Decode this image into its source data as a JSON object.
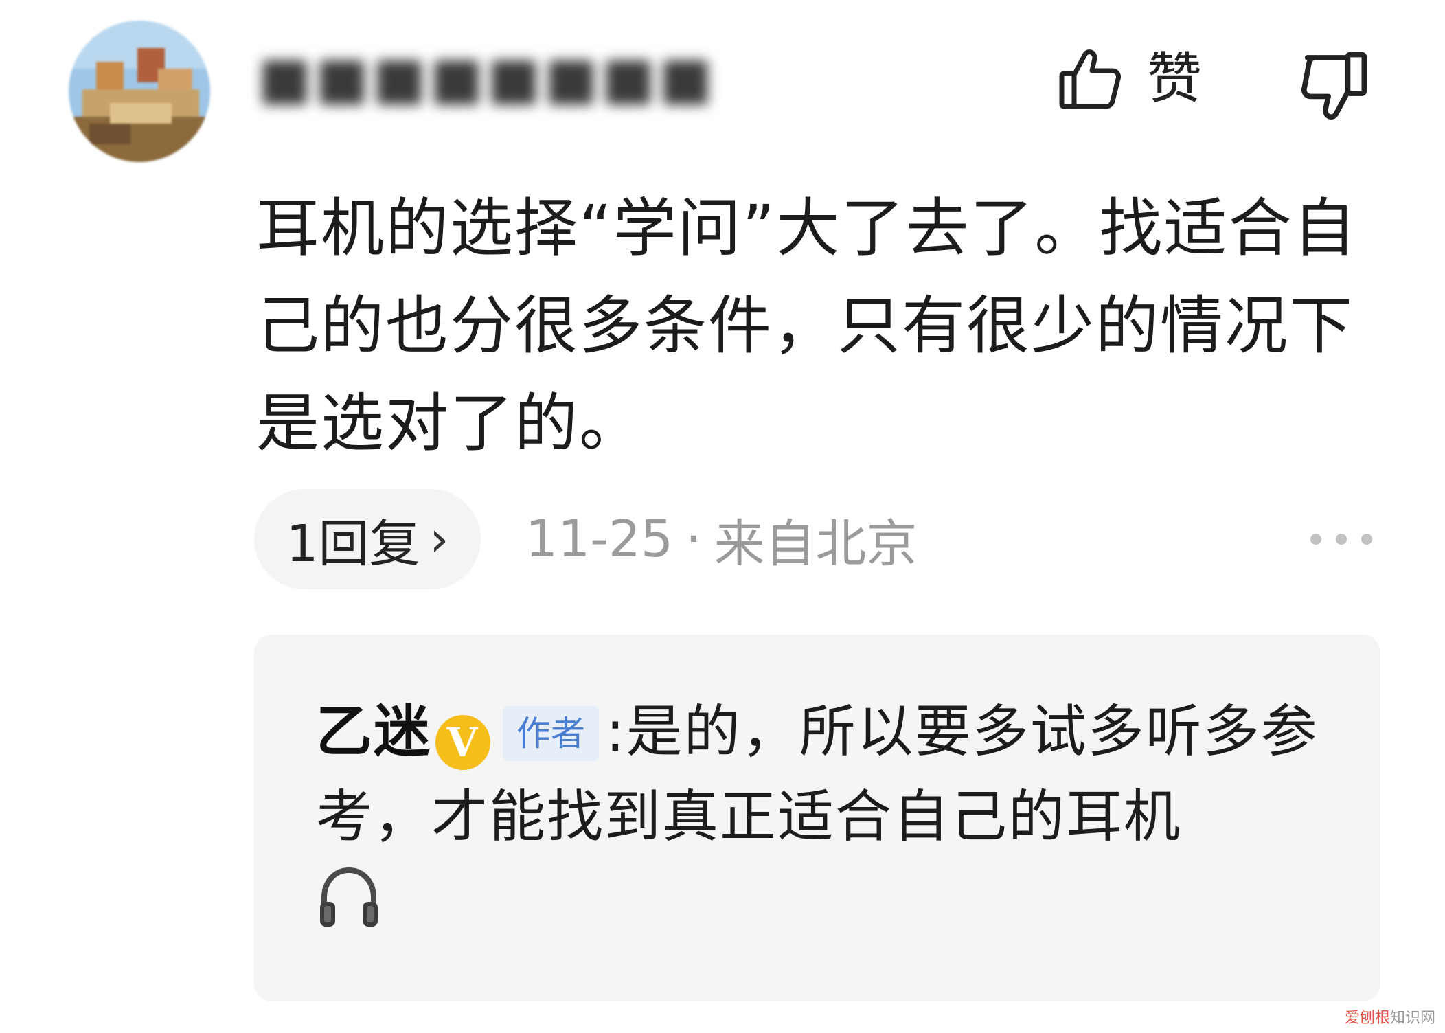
{
  "comment": {
    "username": "■■■■■■■■",
    "like_label": "赞",
    "body": "耳机的选择“学问”大了去了。找适合自己的也分很多条件，只有很少的情况下是选对了的。",
    "reply_count_label": "1回复",
    "date": "11-25",
    "separator": "·",
    "location": "来自北京"
  },
  "reply": {
    "author": "乙迷",
    "vip_letter": "V",
    "author_tag": "作者",
    "colon": ":",
    "text": "是的，所以要多试多听多参考，才能找到真正适合自己的耳机"
  },
  "icons": {
    "like": "thumbs-up-icon",
    "dislike": "thumbs-down-icon",
    "more": "more-dots-icon",
    "chevron": "chevron-right-icon",
    "vip": "verified-v-badge-icon",
    "emoji": "headphone-icon"
  },
  "colors": {
    "vip_badge": "#f6be1b",
    "author_tag_bg": "#e6eef9",
    "author_tag_text": "#4a7ed0",
    "meta_text": "#9b9b9b",
    "reply_card_bg": "#f5f5f5"
  },
  "watermark": {
    "part1": "爱刨根",
    "part2": "知识网"
  }
}
